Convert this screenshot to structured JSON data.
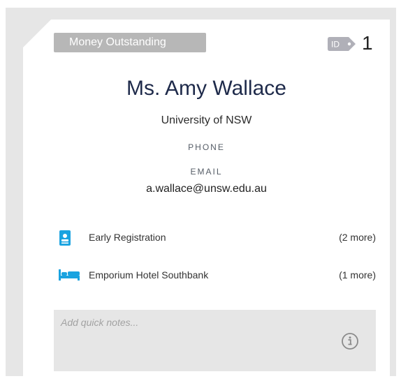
{
  "card": {
    "status": "Money Outstanding",
    "id_label": "ID",
    "id_number": "1",
    "name": "Ms. Amy Wallace",
    "organization": "University of NSW",
    "phone_label": "PHONE",
    "email_label": "EMAIL",
    "email": "a.wallace@unsw.edu.au"
  },
  "items": [
    {
      "icon": "id-badge-icon",
      "label": "Early Registration",
      "more": "(2 more)"
    },
    {
      "icon": "bed-icon",
      "label": "Emporium Hotel Southbank",
      "more": "(1 more)"
    }
  ],
  "notes": {
    "placeholder": "Add quick notes...",
    "icon": "info-icon"
  },
  "colors": {
    "accent": "#1aa3e0",
    "badge": "#b7b7b7",
    "name": "#1e2a4a"
  }
}
